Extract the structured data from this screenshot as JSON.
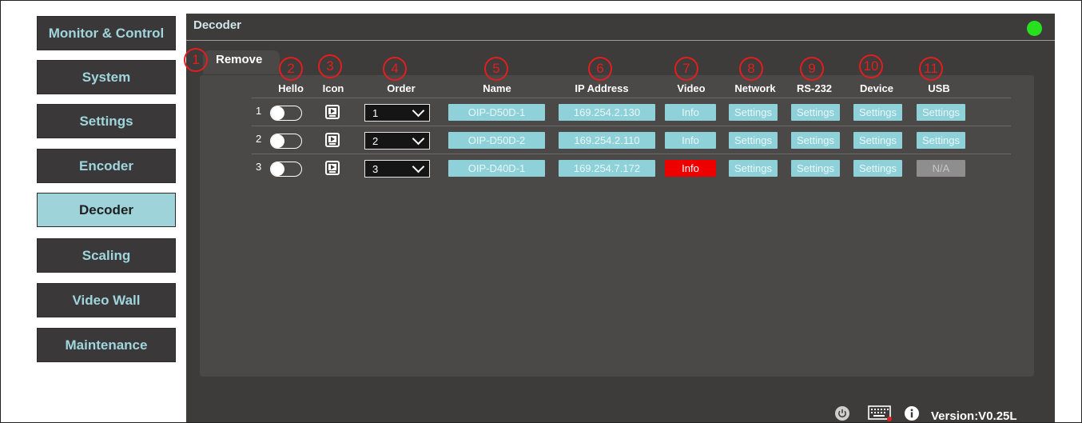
{
  "sidebar": {
    "items": [
      {
        "label": "Monitor & Control",
        "active": false
      },
      {
        "label": "System",
        "active": false
      },
      {
        "label": "Settings",
        "active": false
      },
      {
        "label": "Encoder",
        "active": false
      },
      {
        "label": "Decoder",
        "active": true
      },
      {
        "label": "Scaling",
        "active": false
      },
      {
        "label": "Video Wall",
        "active": false
      },
      {
        "label": "Maintenance",
        "active": false
      }
    ]
  },
  "panel": {
    "title": "Decoder",
    "status_color": "#27e11f",
    "tab_label": "Remove"
  },
  "markers": [
    "1",
    "2",
    "3",
    "4",
    "5",
    "6",
    "7",
    "8",
    "9",
    "10",
    "11"
  ],
  "columns": [
    "Hello",
    "Icon",
    "Order",
    "Name",
    "IP Address",
    "Video",
    "Network",
    "RS-232",
    "Device",
    "USB"
  ],
  "rows": [
    {
      "num": "1",
      "order": "1",
      "name": "OIP-D50D-1",
      "ip": "169.254.2.130",
      "video": "Info",
      "network": "Settings",
      "rs232": "Settings",
      "device": "Settings",
      "usb": "Settings"
    },
    {
      "num": "2",
      "order": "2",
      "name": "OIP-D50D-2",
      "ip": "169.254.2.110",
      "video": "Info",
      "network": "Settings",
      "rs232": "Settings",
      "device": "Settings",
      "usb": "Settings"
    },
    {
      "num": "3",
      "order": "3",
      "name": "OIP-D40D-1",
      "ip": "169.254.7.172",
      "video": "Info",
      "network": "Settings",
      "rs232": "Settings",
      "device": "Settings",
      "usb": "N/A"
    }
  ],
  "footer": {
    "icons": [
      "power-icon",
      "keyboard-icon",
      "info-icon"
    ],
    "version": "Version:V0.25L"
  },
  "colors": {
    "accent": "#9ed3da",
    "alert": "#ee0000",
    "panel": "#3e3b3b"
  }
}
